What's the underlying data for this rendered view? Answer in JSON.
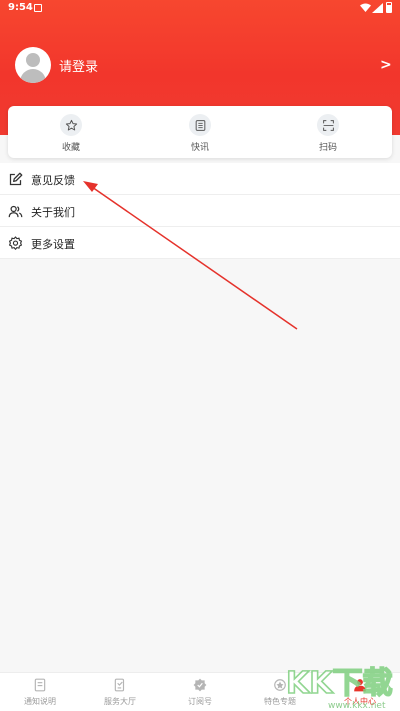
{
  "colors": {
    "brand_red": "#f03a30",
    "active_tab": "#e8342a",
    "inactive_tab": "#9a9a9a"
  },
  "status_bar": {
    "time": "9:54"
  },
  "profile": {
    "login_label": "请登录",
    "avatar_icon": "user-avatar-icon",
    "chevron_icon": "chevron-right-icon"
  },
  "quick_actions": [
    {
      "label": "收藏",
      "icon": "star-icon"
    },
    {
      "label": "快讯",
      "icon": "news-list-icon"
    },
    {
      "label": "扫码",
      "icon": "scan-icon"
    }
  ],
  "menu": [
    {
      "label": "意见反馈",
      "icon": "edit-icon"
    },
    {
      "label": "关于我们",
      "icon": "users-icon"
    },
    {
      "label": "更多设置",
      "icon": "gear-icon"
    }
  ],
  "tabs": [
    {
      "label": "通知说明",
      "icon": "notice-icon",
      "active": false
    },
    {
      "label": "服务大厅",
      "icon": "service-icon",
      "active": false
    },
    {
      "label": "订阅号",
      "icon": "subscribe-icon",
      "active": false
    },
    {
      "label": "特色专题",
      "icon": "topic-icon",
      "active": false
    },
    {
      "label": "个人中心",
      "icon": "person-icon",
      "active": true
    }
  ],
  "watermark": {
    "brand": "KK下载",
    "url": "www.kkx.net"
  }
}
